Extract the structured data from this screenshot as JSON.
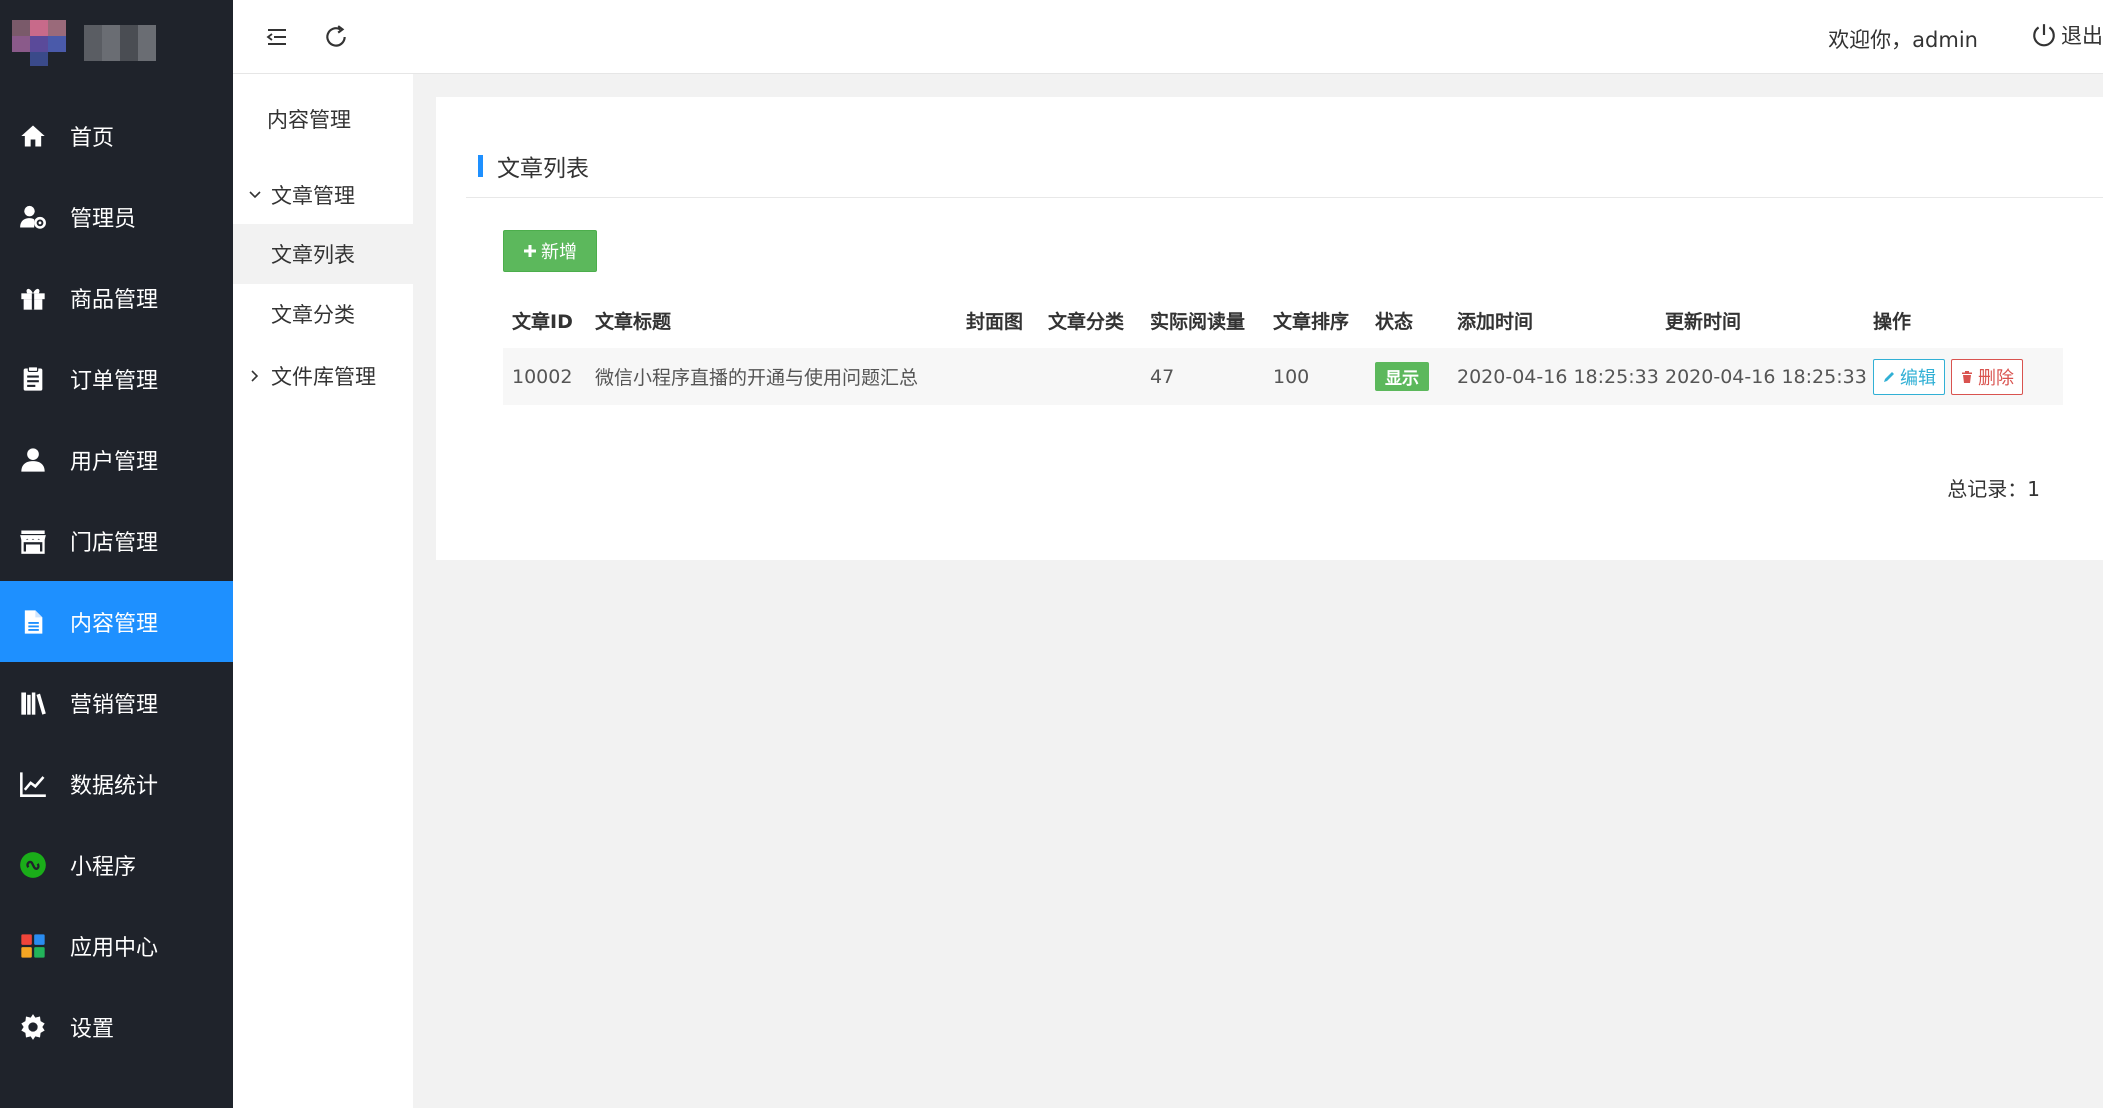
{
  "sidebar": {
    "items": [
      {
        "label": "首页",
        "icon": "home-icon"
      },
      {
        "label": "管理员",
        "icon": "user-gear-icon"
      },
      {
        "label": "商品管理",
        "icon": "gift-icon"
      },
      {
        "label": "订单管理",
        "icon": "clipboard-icon"
      },
      {
        "label": "用户管理",
        "icon": "user-icon"
      },
      {
        "label": "门店管理",
        "icon": "store-icon"
      },
      {
        "label": "内容管理",
        "icon": "file-icon",
        "active": true
      },
      {
        "label": "营销管理",
        "icon": "books-icon"
      },
      {
        "label": "数据统计",
        "icon": "line-chart-icon"
      },
      {
        "label": "小程序",
        "icon": "mini-program-icon"
      },
      {
        "label": "应用中心",
        "icon": "apps-icon"
      },
      {
        "label": "设置",
        "icon": "gear-icon"
      }
    ],
    "active_color": "#1e90ff",
    "background": "#1f232b"
  },
  "subsidebar": {
    "title": "内容管理",
    "groups": [
      {
        "label": "文章管理",
        "expanded": true,
        "children": [
          "文章列表",
          "文章分类"
        ]
      },
      {
        "label": "文件库管理",
        "expanded": false
      }
    ],
    "active_child": "文章列表"
  },
  "header": {
    "welcome": "欢迎你，admin",
    "logout": "退出"
  },
  "main": {
    "title": "文章列表",
    "add_button": "新增",
    "table": {
      "columns": [
        "文章ID",
        "文章标题",
        "封面图",
        "文章分类",
        "实际阅读量",
        "文章排序",
        "状态",
        "添加时间",
        "更新时间",
        "操作"
      ],
      "rows": [
        {
          "id": "10002",
          "title": "微信小程序直播的开通与使用问题汇总",
          "cover": "",
          "category": "",
          "views": "47",
          "sort": "100",
          "status": "显示",
          "created": "2020-04-16 18:25:33",
          "updated": "2020-04-16 18:25:33",
          "edit": "编辑",
          "delete": "删除"
        }
      ]
    },
    "total": "总记录：1"
  }
}
